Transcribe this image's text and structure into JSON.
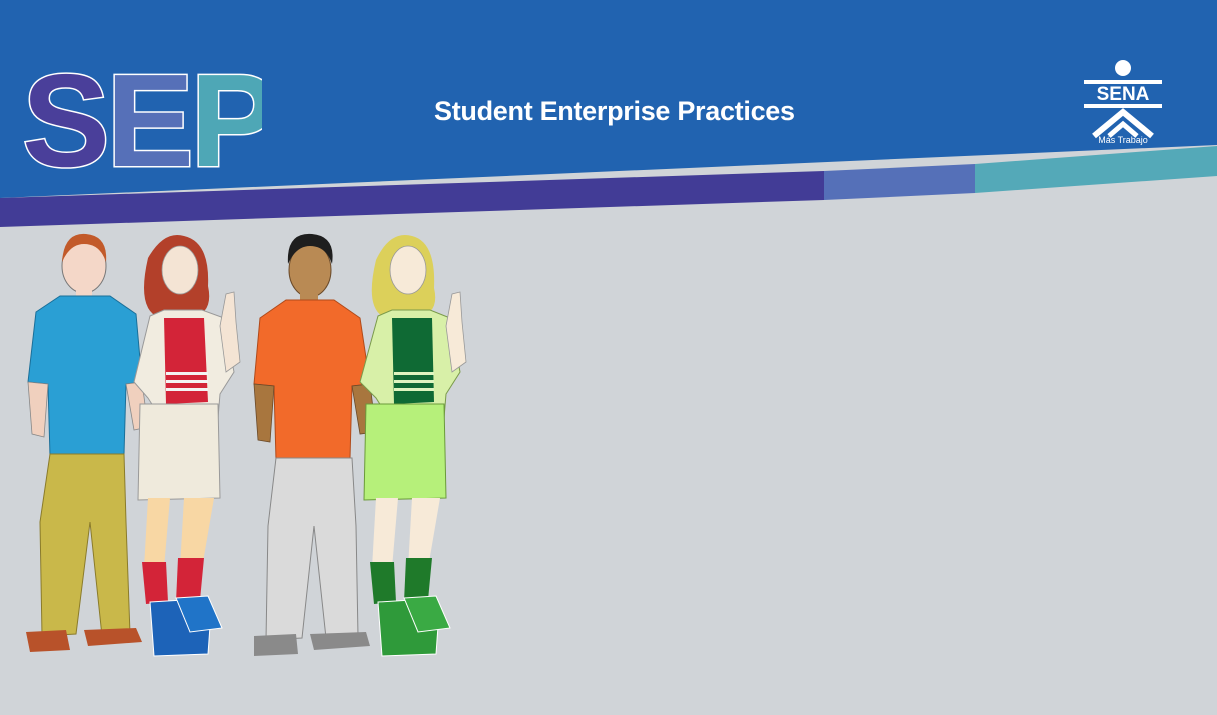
{
  "banner": {
    "acronym": "SEP",
    "headline": "Student Enterprise Practices",
    "colors": {
      "base_blue": "#2163b0",
      "stripe_purple": "#423c96",
      "stripe_blue": "#5570b8",
      "stripe_teal": "#54a9b8",
      "background": "#d0d4d8"
    }
  },
  "sena_logo": {
    "name": "SENA",
    "tagline": "Más Trabajo"
  },
  "illustration": {
    "subject": "students-group-icon"
  }
}
